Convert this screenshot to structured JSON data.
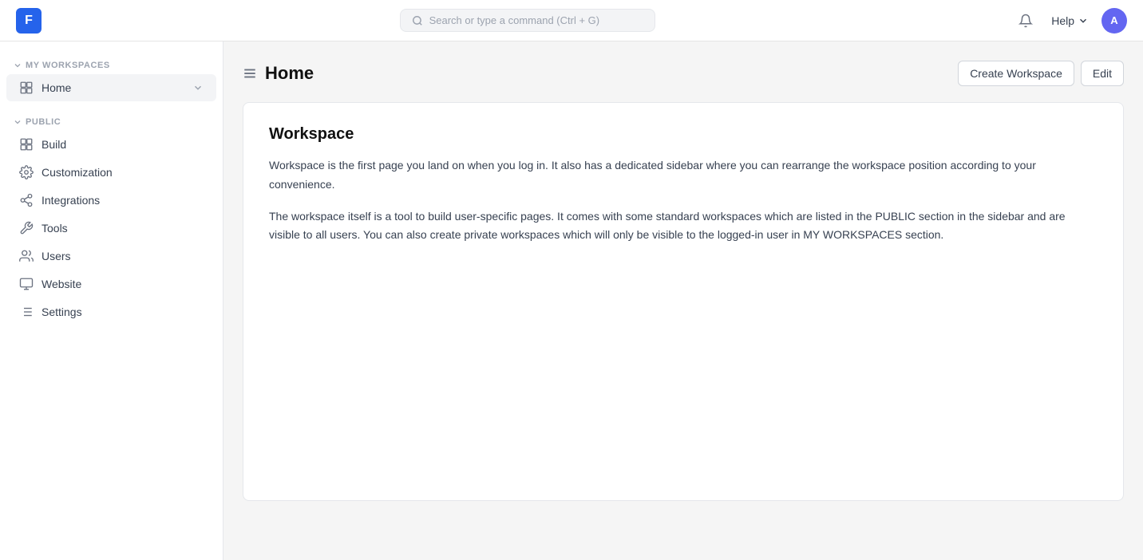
{
  "navbar": {
    "logo_letter": "F",
    "search_placeholder": "Search or type a command (Ctrl + G)",
    "help_label": "Help",
    "avatar_letter": "A"
  },
  "header": {
    "title": "Home",
    "create_workspace_label": "Create Workspace",
    "edit_label": "Edit"
  },
  "sidebar": {
    "my_workspaces_label": "MY WORKSPACES",
    "public_label": "PUBLIC",
    "my_workspace_items": [
      {
        "id": "home",
        "label": "Home",
        "active": true
      }
    ],
    "public_items": [
      {
        "id": "build",
        "label": "Build"
      },
      {
        "id": "customization",
        "label": "Customization"
      },
      {
        "id": "integrations",
        "label": "Integrations"
      },
      {
        "id": "tools",
        "label": "Tools"
      },
      {
        "id": "users",
        "label": "Users"
      },
      {
        "id": "website",
        "label": "Website"
      },
      {
        "id": "settings",
        "label": "Settings"
      }
    ]
  },
  "content": {
    "heading": "Workspace",
    "paragraph1": "Workspace is the first page you land on when you log in. It also has a dedicated sidebar where you can rearrange the workspace position according to your convenience.",
    "paragraph2": "The workspace itself is a tool to build user-specific pages. It comes with some standard workspaces which are listed in the PUBLIC section in the sidebar and are visible to all users. You can also create private workspaces which will only be visible to the logged-in user in MY WORKSPACES section."
  }
}
